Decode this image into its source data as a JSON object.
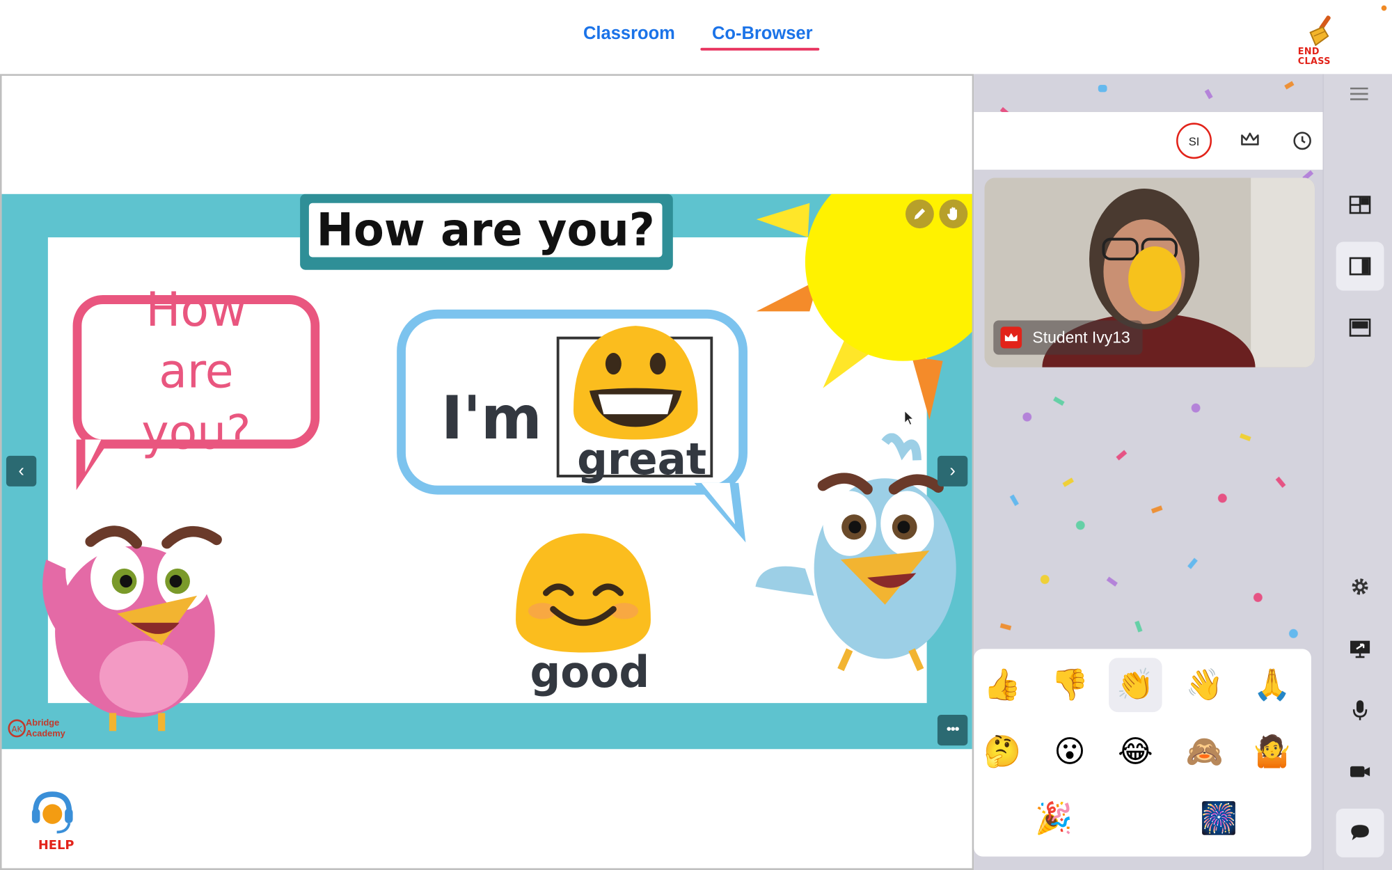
{
  "tabs": [
    {
      "label": "Classroom",
      "active": false
    },
    {
      "label": "Co-Browser",
      "active": true
    }
  ],
  "end_class": {
    "label": "END CLASS",
    "icon": "broom-icon"
  },
  "slide": {
    "title": "How are you?",
    "question_bubble": "How are you?",
    "answer_prefix": "I'm",
    "answer_great": "great",
    "answer_good": "good",
    "logo_line1": "Abridge",
    "logo_line2": "Academy"
  },
  "participant": {
    "avatar_initials": "SI",
    "name": "Student Ivy13"
  },
  "emoji_reactions": [
    "👍",
    "👎",
    "👏",
    "👋",
    "🙏",
    "🤔",
    "😮",
    "😂",
    "🙈",
    "🤷",
    "🎉",
    "🎆"
  ],
  "help": {
    "label": "HELP"
  },
  "colors": {
    "accent": "#1b73e8",
    "active_underline": "#e8345f",
    "end_class": "#e2231a",
    "slide_bg": "#5ec3cf"
  }
}
